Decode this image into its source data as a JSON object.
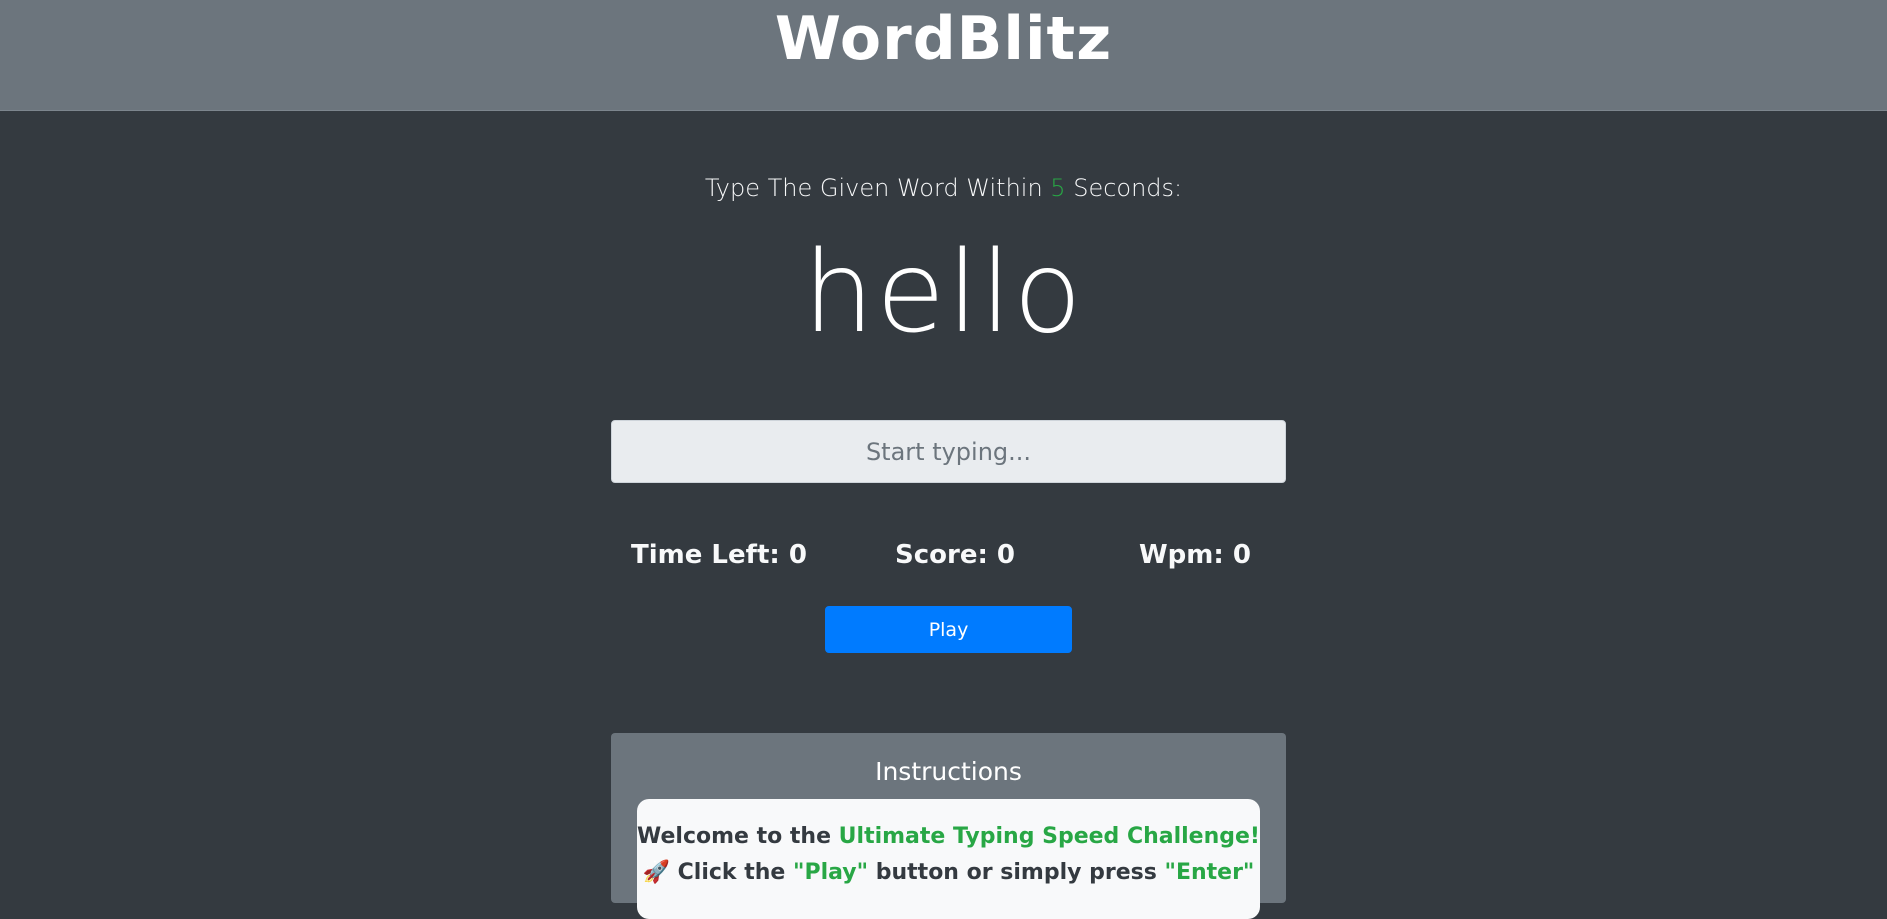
{
  "header": {
    "title": "WordBlitz"
  },
  "prompt": {
    "before": "Type The Given Word Within ",
    "seconds": "5",
    "after": " Seconds:"
  },
  "current_word": "hello",
  "input": {
    "placeholder": "Start typing...",
    "value": ""
  },
  "stats": {
    "time_left": "Time Left: 0",
    "score": "Score: 0",
    "wpm": "Wpm: 0"
  },
  "play_button": {
    "label": "Play"
  },
  "instructions": {
    "title": "Instructions",
    "line1_prefix": "Welcome to the ",
    "line1_highlight": "Ultimate Typing Speed Challenge!",
    "line2_icon": "🚀",
    "line2_a": " Click the ",
    "line2_play": "\"Play\"",
    "line2_b": " button or simply press ",
    "line2_enter": "\"Enter\""
  },
  "colors": {
    "background": "#343a40",
    "header": "#6c757d",
    "accent_green": "#28a745",
    "primary_blue": "#007bff"
  },
  "icons": {
    "rocket": "rocket-icon"
  }
}
